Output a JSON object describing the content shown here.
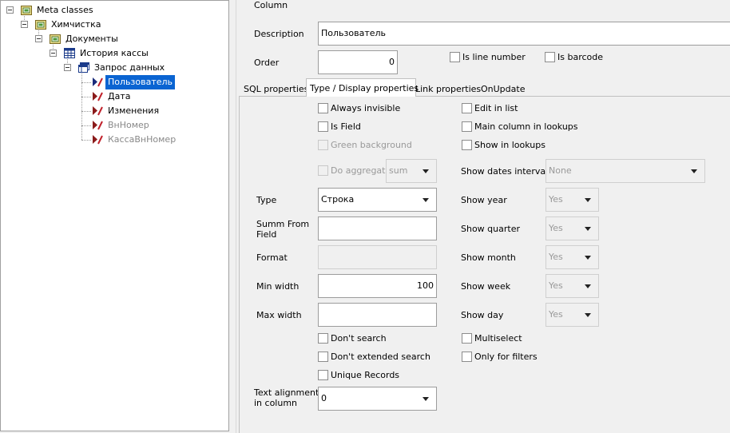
{
  "tree": {
    "nodes": [
      {
        "label": "Meta classes"
      },
      {
        "label": "Химчистка"
      },
      {
        "label": "Документы"
      },
      {
        "label": "История кассы"
      },
      {
        "label": "Запрос данных"
      },
      {
        "label": "Пользователь"
      },
      {
        "label": "Дата"
      },
      {
        "label": "Изменения"
      },
      {
        "label": "ВнНомер"
      },
      {
        "label": "КассаВнНомер"
      }
    ]
  },
  "header": {
    "column_label": "Column",
    "description_label": "Description",
    "description_value": "Пользователь",
    "order_label": "Order",
    "order_value": "0",
    "is_line_number": "Is line number",
    "is_barcode": "Is barcode"
  },
  "tabs": [
    {
      "label": "SQL properties"
    },
    {
      "label": "Type / Display properties"
    },
    {
      "label": "Link properties"
    },
    {
      "label": "OnUpdate"
    }
  ],
  "display": {
    "always_invisible": "Always invisible",
    "is_field": "Is Field",
    "green_background": "Green background",
    "do_aggregate": "Do aggregate",
    "aggregate_value": "sum",
    "type_label": "Type",
    "type_value": "Строка",
    "summ_from_field_label_1": "Summ From",
    "summ_from_field_label_2": "Field",
    "summ_from_field_value": "",
    "format_label": "Format",
    "format_value": "",
    "min_width_label": "Min width",
    "min_width_value": "100",
    "max_width_label": "Max width",
    "max_width_value": "",
    "dont_search": "Don't search",
    "dont_extended_search": "Don't extended search",
    "unique_records": "Unique Records",
    "text_alignment_label_1": "Text alignment",
    "text_alignment_label_2": "in column",
    "text_alignment_value": "0",
    "edit_in_list": "Edit in list",
    "main_column_in_lookups": "Main column in lookups",
    "show_in_lookups": "Show in lookups",
    "show_dates_interval_label": "Show dates interval",
    "show_dates_interval_value": "None",
    "show_year_label": "Show year",
    "show_year_value": "Yes",
    "show_quarter_label": "Show quarter",
    "show_quarter_value": "Yes",
    "show_month_label": "Show month",
    "show_month_value": "Yes",
    "show_week_label": "Show week",
    "show_week_value": "Yes",
    "show_day_label": "Show day",
    "show_day_value": "Yes",
    "multiselect": "Multiselect",
    "only_for_filters": "Only for filters"
  }
}
